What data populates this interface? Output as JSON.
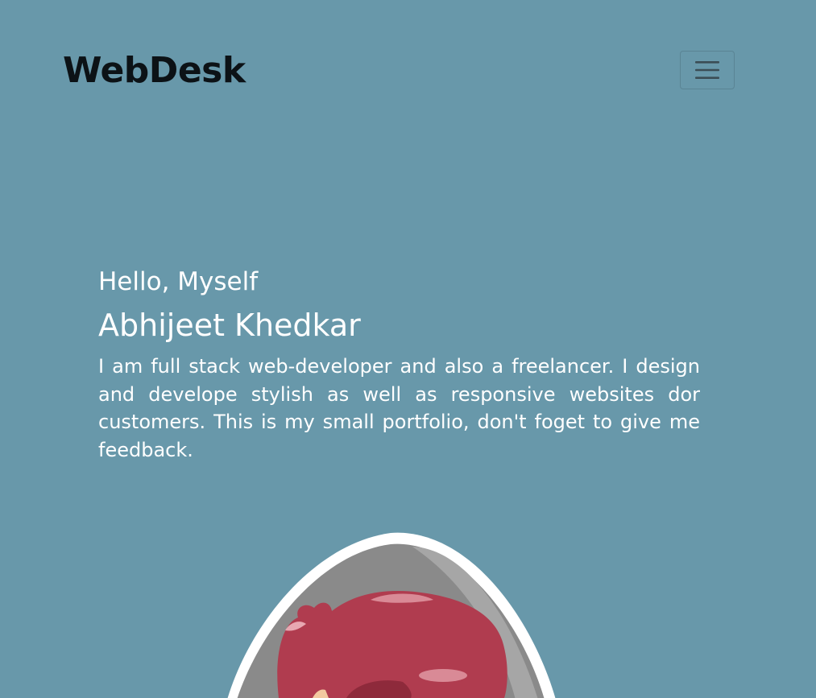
{
  "navbar": {
    "brand": "WebDesk",
    "toggle_icon": "hamburger-menu-icon"
  },
  "hero": {
    "greeting": "Hello, Myself",
    "name": "Abhijeet Khedkar",
    "about": "I am full stack web-developer and also a freelancer. I design and develope stylish as well as responsive websites dor customers. This is my small portfolio, don't foget to give me feedback."
  },
  "avatar": {
    "icon": "cartoon-avatar-illustration"
  },
  "colors": {
    "background": "#6898aa",
    "brand_text": "#0c1216",
    "hero_text": "#ffffff",
    "avatar_hair": "#b03c4f",
    "avatar_frame": "#8a8a8a"
  }
}
